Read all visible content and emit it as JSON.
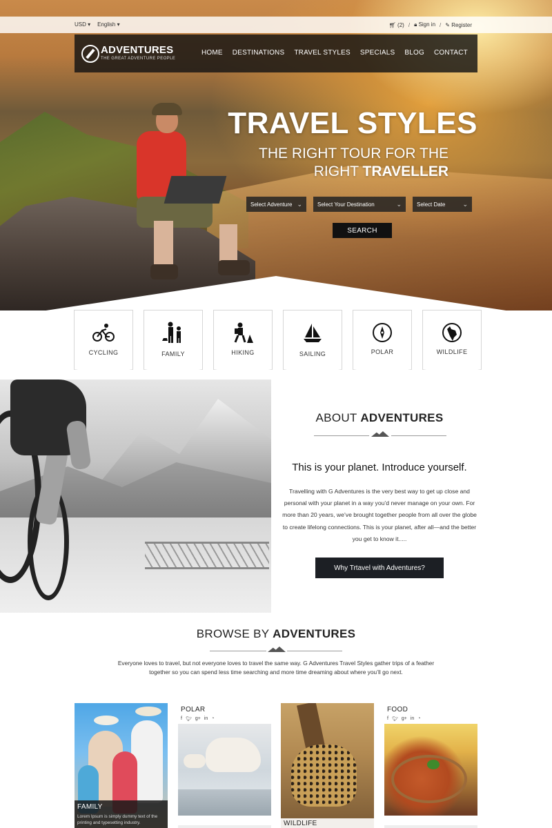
{
  "topbar": {
    "currency": "USD",
    "language": "English",
    "cart": "(2)",
    "signin": "Sign in",
    "register": "Register"
  },
  "brand": {
    "name": "ADVENTURES",
    "tagline": "THE GREAT ADVENTURE PEOPLE"
  },
  "nav": {
    "items": [
      "HOME",
      "DESTINATIONS",
      "TRAVEL STYLES",
      "SPECIALS",
      "BLOG",
      "CONTACT"
    ]
  },
  "hero": {
    "title": "TRAVEL STYLES",
    "subtitle_line1": "THE RIGHT TOUR FOR THE",
    "subtitle_line2_plain": "RIGHT ",
    "subtitle_line2_bold": "TRAVELLER",
    "select_adventure": "Select Adventure",
    "select_destination": "Select Your Destination",
    "select_date": "Select Date",
    "search": "SEARCH"
  },
  "categories": [
    "CYCLING",
    "FAMILY",
    "HIKING",
    "SAILING",
    "POLAR",
    "WILDLIFE"
  ],
  "about": {
    "title_plain": "ABOUT ",
    "title_bold": "ADVENTURES",
    "heading": "This is your planet. Introduce yourself.",
    "text": "Travelling with G Adventures is the very best way to get up close and personal with your planet in a way you’d never manage on your own. For more than 20 years, we’ve brought together people from all over the globe to create lifelong connections. This is your planet, after all—and the better you get to know it.....",
    "button": "Why Trtavel with Adventures?"
  },
  "browse": {
    "title_plain": "BROWSE BY ",
    "title_bold": "ADVENTURES",
    "text": "Everyone loves to travel, but not everyone loves to travel the same way. G Adventures Travel Styles gather trips of a feather together so you can spend less time searching and more time dreaming about where you’ll go next."
  },
  "cards": {
    "family": {
      "title": "FAMILY",
      "desc": "Lorem Ipsum is simply dummy text of the printing and typesetting industry."
    },
    "polar": {
      "title": "POLAR"
    },
    "wildlife": {
      "title": "WILDLIFE"
    },
    "food": {
      "title": "FOOD"
    },
    "social_icons": [
      "facebook-icon",
      "twitter-icon",
      "google-plus-icon",
      "linkedin-icon",
      "rss-icon"
    ]
  }
}
